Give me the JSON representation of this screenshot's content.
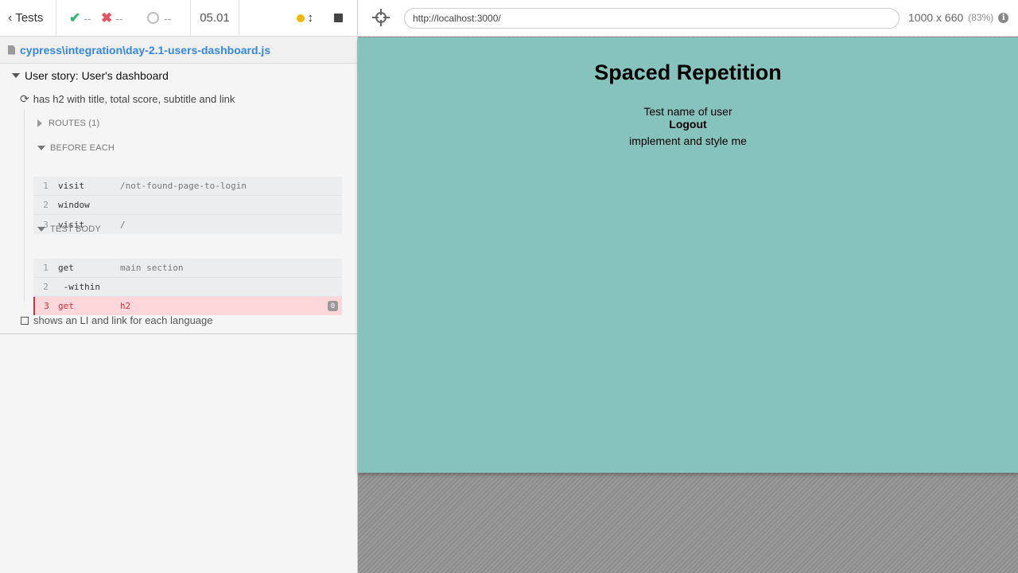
{
  "reporter": {
    "tests_label": "Tests",
    "passed": "--",
    "failed": "--",
    "pending": "--",
    "duration": "05.01",
    "spec_path": "cypress\\integration\\day-2.1-users-dashboard.js",
    "suite_title": "User story: User's dashboard",
    "test1_title": "has h2 with title, total score, subtitle and link",
    "routes_label": "ROUTES (1)",
    "before_each_label": "BEFORE EACH",
    "test_body_label": "TEST BODY",
    "before_each_cmds": [
      {
        "num": "1",
        "name": "visit",
        "msg": "/not-found-page-to-login"
      },
      {
        "num": "2",
        "name": "window",
        "msg": ""
      },
      {
        "num": "3",
        "name": "visit",
        "msg": "/"
      }
    ],
    "test_body_cmds": [
      {
        "num": "1",
        "name": "get",
        "msg": "main section"
      },
      {
        "num": "2",
        "name": " -within",
        "msg": ""
      },
      {
        "num": "3",
        "name": "get",
        "msg": "h2",
        "badge": "0"
      }
    ],
    "test2_title": "shows an LI and link for each language"
  },
  "aut": {
    "url": "http://localhost:3000/",
    "viewport": "1000 x 660",
    "scale": "(83%)",
    "app": {
      "title": "Spaced Repetition",
      "user_name": "Test name of user",
      "logout": "Logout",
      "placeholder": "implement and style me"
    }
  },
  "colors": {
    "app_bg": "#87c3bd",
    "pass": "#2eb872",
    "fail": "#e94f5f",
    "running": "#f5b500",
    "link": "#3486e3"
  }
}
